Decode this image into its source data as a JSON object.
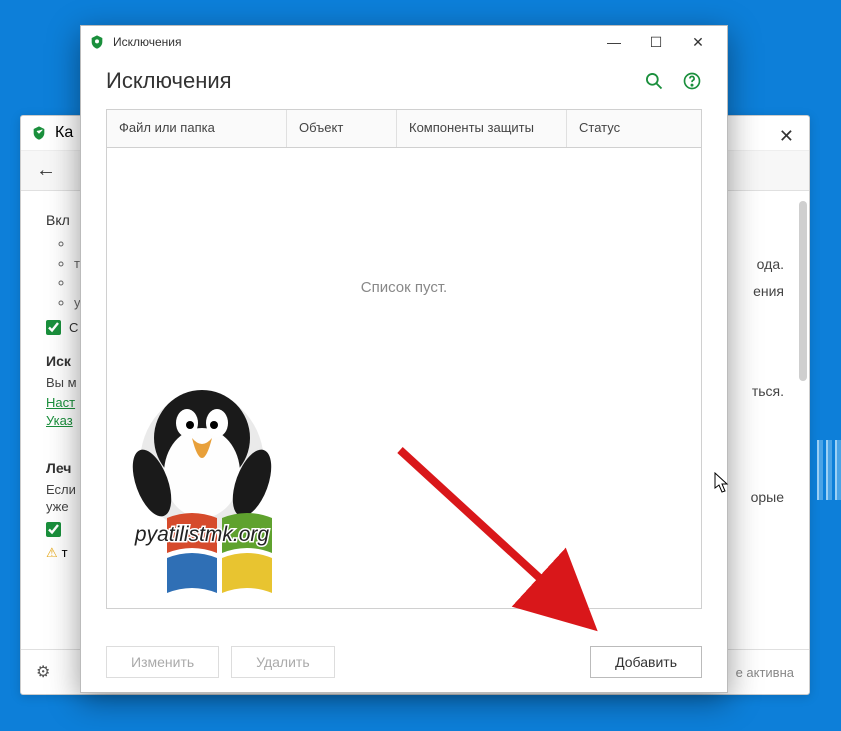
{
  "back_window": {
    "title_prefix": "Ка",
    "section1_title": "Вкл",
    "right_text1": "ода.",
    "right_text2": "ения",
    "isk_title": "Иск",
    "isk_line": "Вы м",
    "right_text3": "ться.",
    "link1": "Наст",
    "link2": "Указ",
    "lech_title": "Леч",
    "lech_line": "Если",
    "lech_line2": "уже",
    "right_text4": "орые",
    "footer_right": "е активна"
  },
  "front_window": {
    "titlebar": "Исключения",
    "header": "Исключения",
    "columns": {
      "file_folder": "Файл или папка",
      "object": "Объект",
      "components": "Компоненты защиты",
      "status": "Статус"
    },
    "empty_message": "Список пуст.",
    "buttons": {
      "edit": "Изменить",
      "delete": "Удалить",
      "add": "Добавить"
    }
  },
  "watermark_text": "pyatilistmk.org"
}
